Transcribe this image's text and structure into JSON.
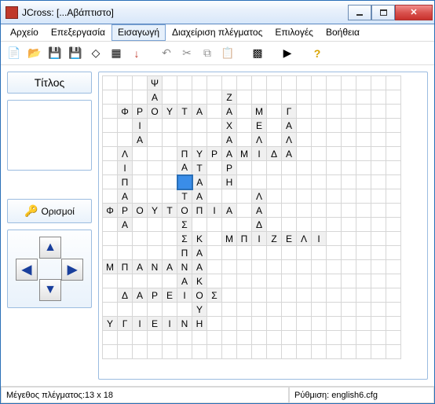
{
  "window": {
    "title": "JCross: [...Αβάπτιστο]"
  },
  "menu": {
    "items": [
      "Αρχείο",
      "Επεξεργασία",
      "Εισαγωγή",
      "Διαχείριση πλέγματος",
      "Επιλογές",
      "Βοήθεια"
    ],
    "active_index": 2
  },
  "toolbar": {
    "icons": [
      {
        "name": "new-icon",
        "glyph": "📄"
      },
      {
        "name": "open-icon",
        "glyph": "📂"
      },
      {
        "name": "save-icon",
        "glyph": "💾"
      },
      {
        "name": "save-as-icon",
        "glyph": "💾"
      },
      {
        "name": "erase-icon",
        "glyph": "◇"
      },
      {
        "name": "grid-tool-icon",
        "glyph": "▦"
      },
      {
        "name": "arrow-down-icon",
        "glyph": "↓"
      },
      {
        "name": "sep"
      },
      {
        "name": "undo-icon",
        "glyph": "↶"
      },
      {
        "name": "cut-icon",
        "glyph": "✂"
      },
      {
        "name": "copy-icon",
        "glyph": "⧉"
      },
      {
        "name": "paste-icon",
        "glyph": "📋"
      },
      {
        "name": "sep"
      },
      {
        "name": "grid-size-icon",
        "glyph": "▩"
      },
      {
        "name": "sep"
      },
      {
        "name": "export-icon",
        "glyph": "▶"
      },
      {
        "name": "sep"
      },
      {
        "name": "help-icon",
        "glyph": "?"
      }
    ]
  },
  "panel": {
    "title_label": "Τίτλος",
    "definitions_label": "Ορισμοί"
  },
  "grid": {
    "cols": 20,
    "rows": 20,
    "selected": {
      "row": 7,
      "col": 5
    },
    "cells": [
      {
        "r": 0,
        "c": 3,
        "ch": "Ψ"
      },
      {
        "r": 1,
        "c": 3,
        "ch": "Α"
      },
      {
        "r": 1,
        "c": 8,
        "ch": "Ζ"
      },
      {
        "r": 2,
        "c": 1,
        "ch": "Φ"
      },
      {
        "r": 2,
        "c": 2,
        "ch": "Ρ"
      },
      {
        "r": 2,
        "c": 3,
        "ch": "Ο"
      },
      {
        "r": 2,
        "c": 4,
        "ch": "Υ"
      },
      {
        "r": 2,
        "c": 5,
        "ch": "Τ"
      },
      {
        "r": 2,
        "c": 6,
        "ch": "Α"
      },
      {
        "r": 2,
        "c": 8,
        "ch": "Α"
      },
      {
        "r": 2,
        "c": 10,
        "ch": "Μ"
      },
      {
        "r": 2,
        "c": 12,
        "ch": "Γ"
      },
      {
        "r": 3,
        "c": 2,
        "ch": "Ι"
      },
      {
        "r": 3,
        "c": 8,
        "ch": "Χ"
      },
      {
        "r": 3,
        "c": 10,
        "ch": "Ε"
      },
      {
        "r": 3,
        "c": 12,
        "ch": "Α"
      },
      {
        "r": 4,
        "c": 2,
        "ch": "Α"
      },
      {
        "r": 4,
        "c": 8,
        "ch": "Α"
      },
      {
        "r": 4,
        "c": 10,
        "ch": "Λ"
      },
      {
        "r": 4,
        "c": 12,
        "ch": "Λ"
      },
      {
        "r": 5,
        "c": 1,
        "ch": "Λ"
      },
      {
        "r": 5,
        "c": 5,
        "ch": "Π"
      },
      {
        "r": 5,
        "c": 6,
        "ch": "Υ"
      },
      {
        "r": 5,
        "c": 7,
        "ch": "Ρ"
      },
      {
        "r": 5,
        "c": 8,
        "ch": "Α"
      },
      {
        "r": 5,
        "c": 9,
        "ch": "Μ"
      },
      {
        "r": 5,
        "c": 10,
        "ch": "Ι"
      },
      {
        "r": 5,
        "c": 11,
        "ch": "Δ"
      },
      {
        "r": 5,
        "c": 12,
        "ch": "Α"
      },
      {
        "r": 6,
        "c": 1,
        "ch": "Ι"
      },
      {
        "r": 6,
        "c": 5,
        "ch": "Α"
      },
      {
        "r": 6,
        "c": 6,
        "ch": "Τ"
      },
      {
        "r": 6,
        "c": 8,
        "ch": "Ρ"
      },
      {
        "r": 7,
        "c": 1,
        "ch": "Π"
      },
      {
        "r": 7,
        "c": 6,
        "ch": "Α"
      },
      {
        "r": 7,
        "c": 8,
        "ch": "Η"
      },
      {
        "r": 8,
        "c": 1,
        "ch": "Α"
      },
      {
        "r": 8,
        "c": 5,
        "ch": "Τ"
      },
      {
        "r": 8,
        "c": 6,
        "ch": "Α"
      },
      {
        "r": 8,
        "c": 10,
        "ch": "Λ"
      },
      {
        "r": 9,
        "c": 0,
        "ch": "Φ"
      },
      {
        "r": 9,
        "c": 1,
        "ch": "Ρ"
      },
      {
        "r": 9,
        "c": 2,
        "ch": "Ο"
      },
      {
        "r": 9,
        "c": 3,
        "ch": "Υ"
      },
      {
        "r": 9,
        "c": 4,
        "ch": "Τ"
      },
      {
        "r": 9,
        "c": 5,
        "ch": "Ο"
      },
      {
        "r": 9,
        "c": 6,
        "ch": "Π"
      },
      {
        "r": 9,
        "c": 7,
        "ch": "Ι"
      },
      {
        "r": 9,
        "c": 8,
        "ch": "Α"
      },
      {
        "r": 9,
        "c": 10,
        "ch": "Α"
      },
      {
        "r": 10,
        "c": 1,
        "ch": "Α"
      },
      {
        "r": 10,
        "c": 5,
        "ch": "Σ"
      },
      {
        "r": 10,
        "c": 10,
        "ch": "Δ"
      },
      {
        "r": 11,
        "c": 5,
        "ch": "Σ"
      },
      {
        "r": 11,
        "c": 6,
        "ch": "Κ"
      },
      {
        "r": 11,
        "c": 8,
        "ch": "Μ"
      },
      {
        "r": 11,
        "c": 9,
        "ch": "Π"
      },
      {
        "r": 11,
        "c": 10,
        "ch": "Ι"
      },
      {
        "r": 11,
        "c": 11,
        "ch": "Ζ"
      },
      {
        "r": 11,
        "c": 12,
        "ch": "Ε"
      },
      {
        "r": 11,
        "c": 13,
        "ch": "Λ"
      },
      {
        "r": 11,
        "c": 14,
        "ch": "Ι"
      },
      {
        "r": 12,
        "c": 5,
        "ch": "Π"
      },
      {
        "r": 12,
        "c": 6,
        "ch": "Α"
      },
      {
        "r": 13,
        "c": 0,
        "ch": "Μ"
      },
      {
        "r": 13,
        "c": 1,
        "ch": "Π"
      },
      {
        "r": 13,
        "c": 2,
        "ch": "Α"
      },
      {
        "r": 13,
        "c": 3,
        "ch": "Ν"
      },
      {
        "r": 13,
        "c": 4,
        "ch": "Α"
      },
      {
        "r": 13,
        "c": 5,
        "ch": "Ν"
      },
      {
        "r": 13,
        "c": 6,
        "ch": "Α"
      },
      {
        "r": 14,
        "c": 5,
        "ch": "Α"
      },
      {
        "r": 14,
        "c": 6,
        "ch": "Κ"
      },
      {
        "r": 15,
        "c": 1,
        "ch": "Δ"
      },
      {
        "r": 15,
        "c": 2,
        "ch": "Α"
      },
      {
        "r": 15,
        "c": 3,
        "ch": "Ρ"
      },
      {
        "r": 15,
        "c": 4,
        "ch": "Ε"
      },
      {
        "r": 15,
        "c": 5,
        "ch": "Ι"
      },
      {
        "r": 15,
        "c": 6,
        "ch": "Ο"
      },
      {
        "r": 15,
        "c": 7,
        "ch": "Σ"
      },
      {
        "r": 16,
        "c": 6,
        "ch": "Υ"
      },
      {
        "r": 17,
        "c": 0,
        "ch": "Υ"
      },
      {
        "r": 17,
        "c": 1,
        "ch": "Γ"
      },
      {
        "r": 17,
        "c": 2,
        "ch": "Ι"
      },
      {
        "r": 17,
        "c": 3,
        "ch": "Ε"
      },
      {
        "r": 17,
        "c": 4,
        "ch": "Ι"
      },
      {
        "r": 17,
        "c": 5,
        "ch": "Ν"
      },
      {
        "r": 17,
        "c": 6,
        "ch": "Η"
      }
    ]
  },
  "status": {
    "size_label": "Μέγεθος πλέγματος:13 x 18",
    "config_label": "Ρύθμιση: english6.cfg"
  }
}
